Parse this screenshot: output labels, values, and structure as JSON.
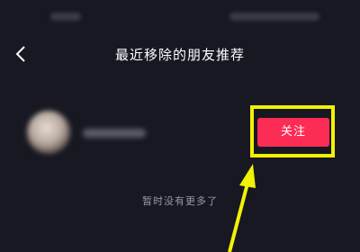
{
  "header": {
    "title": "最近移除的朋友推荐",
    "back_icon": "chevron-left-icon"
  },
  "friend": {
    "follow_label": "关注"
  },
  "footer": {
    "no_more_text": "暂时没有更多了"
  },
  "annotation": {
    "color": "#f2f205"
  },
  "colors": {
    "background": "#171822",
    "accent": "#fd2c55"
  }
}
